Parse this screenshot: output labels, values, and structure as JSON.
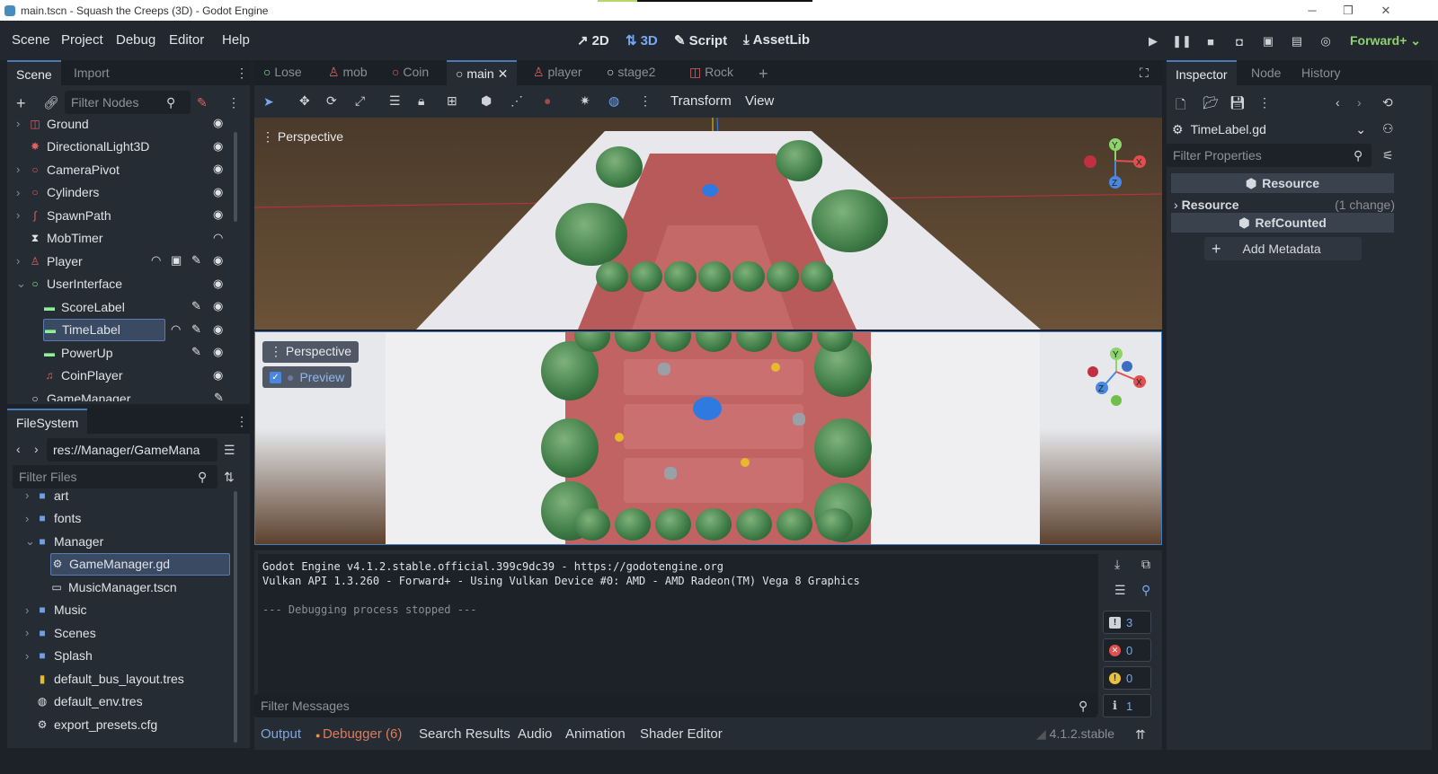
{
  "window": {
    "title": "main.tscn - Squash the Creeps (3D) - Godot Engine",
    "minimize": "─",
    "maximize": "❐",
    "close": "✕"
  },
  "menu": {
    "items": [
      "Scene",
      "Project",
      "Debug",
      "Editor",
      "Help"
    ]
  },
  "main_screens": {
    "d2": "2D",
    "d3": "3D",
    "script": "Script",
    "assetlib": "AssetLib"
  },
  "renderer": "Forward+",
  "scene_dock": {
    "tabs": [
      "Scene",
      "Import"
    ],
    "filter_placeholder": "Filter Nodes",
    "nodes": [
      {
        "label": "Ground",
        "icon": "mesh-icon",
        "color": "#e06060"
      },
      {
        "label": "DirectionalLight3D",
        "icon": "light-icon",
        "color": "#e06060"
      },
      {
        "label": "CameraPivot",
        "icon": "node3d-icon",
        "color": "#e06060"
      },
      {
        "label": "Cylinders",
        "icon": "node3d-icon",
        "color": "#e06060"
      },
      {
        "label": "SpawnPath",
        "icon": "path-icon",
        "color": "#e06060"
      },
      {
        "label": "MobTimer",
        "icon": "timer-icon",
        "color": "#dfe3e8"
      },
      {
        "label": "Player",
        "icon": "character-icon",
        "color": "#e06060"
      },
      {
        "label": "UserInterface",
        "icon": "control-icon",
        "color": "#8eef97"
      },
      {
        "label": "ScoreLabel",
        "icon": "label-icon",
        "color": "#8eef97"
      },
      {
        "label": "TimeLabel",
        "icon": "label-icon",
        "color": "#8eef97"
      },
      {
        "label": "PowerUp",
        "icon": "label-icon",
        "color": "#8eef97"
      },
      {
        "label": "CoinPlayer",
        "icon": "audio-icon",
        "color": "#e06060"
      },
      {
        "label": "GameManager",
        "icon": "node-icon",
        "color": "#dfe3e8"
      }
    ]
  },
  "filesystem": {
    "title": "FileSystem",
    "path": "res://Manager/GameMana",
    "filter_placeholder": "Filter Files",
    "items": [
      {
        "label": "art",
        "depth": 1,
        "type": "folder"
      },
      {
        "label": "fonts",
        "depth": 1,
        "type": "folder"
      },
      {
        "label": "Manager",
        "depth": 1,
        "type": "folder-open"
      },
      {
        "label": "GameManager.gd",
        "depth": 2,
        "type": "gear"
      },
      {
        "label": "MusicManager.tscn",
        "depth": 2,
        "type": "scene"
      },
      {
        "label": "Music",
        "depth": 1,
        "type": "folder"
      },
      {
        "label": "Scenes",
        "depth": 1,
        "type": "folder"
      },
      {
        "label": "Splash",
        "depth": 1,
        "type": "folder"
      },
      {
        "label": "default_bus_layout.tres",
        "depth": 1,
        "type": "bus"
      },
      {
        "label": "default_env.tres",
        "depth": 1,
        "type": "globe"
      },
      {
        "label": "export_presets.cfg",
        "depth": 1,
        "type": "gear"
      }
    ]
  },
  "scene_tabs": [
    "Lose",
    "mob",
    "Coin",
    "main",
    "player",
    "stage2",
    "Rock"
  ],
  "toolbar": {
    "transform": "Transform",
    "view": "View"
  },
  "viewport": {
    "perspective_top": "Perspective",
    "perspective_bottom": "Perspective",
    "preview": "Preview"
  },
  "gizmo": {
    "x": "X",
    "y": "Y",
    "z": "Z"
  },
  "console": {
    "lines": [
      "Godot Engine v4.1.2.stable.official.399c9dc39 - https://godotengine.org",
      "Vulkan API 1.3.260 - Forward+ - Using Vulkan Device #0: AMD - AMD Radeon(TM) Vega 8 Graphics",
      "",
      "--- Debugging process stopped ---"
    ],
    "filter_placeholder": "Filter Messages",
    "counts": {
      "messages": "3",
      "errors": "0",
      "warnings": "0",
      "editor": "1"
    }
  },
  "bottom_tabs": [
    "Output",
    "Debugger (6)",
    "Search Results",
    "Audio",
    "Animation",
    "Shader Editor"
  ],
  "version": "4.1.2.stable",
  "inspector": {
    "tabs": [
      "Inspector",
      "Node",
      "History"
    ],
    "resource": "TimeLabel.gd",
    "filter_placeholder": "Filter Properties",
    "section_resource": "Resource",
    "resource_prop": "Resource",
    "resource_change": "(1 change)",
    "section_refcounted": "RefCounted",
    "add_metadata": "Add Metadata"
  }
}
